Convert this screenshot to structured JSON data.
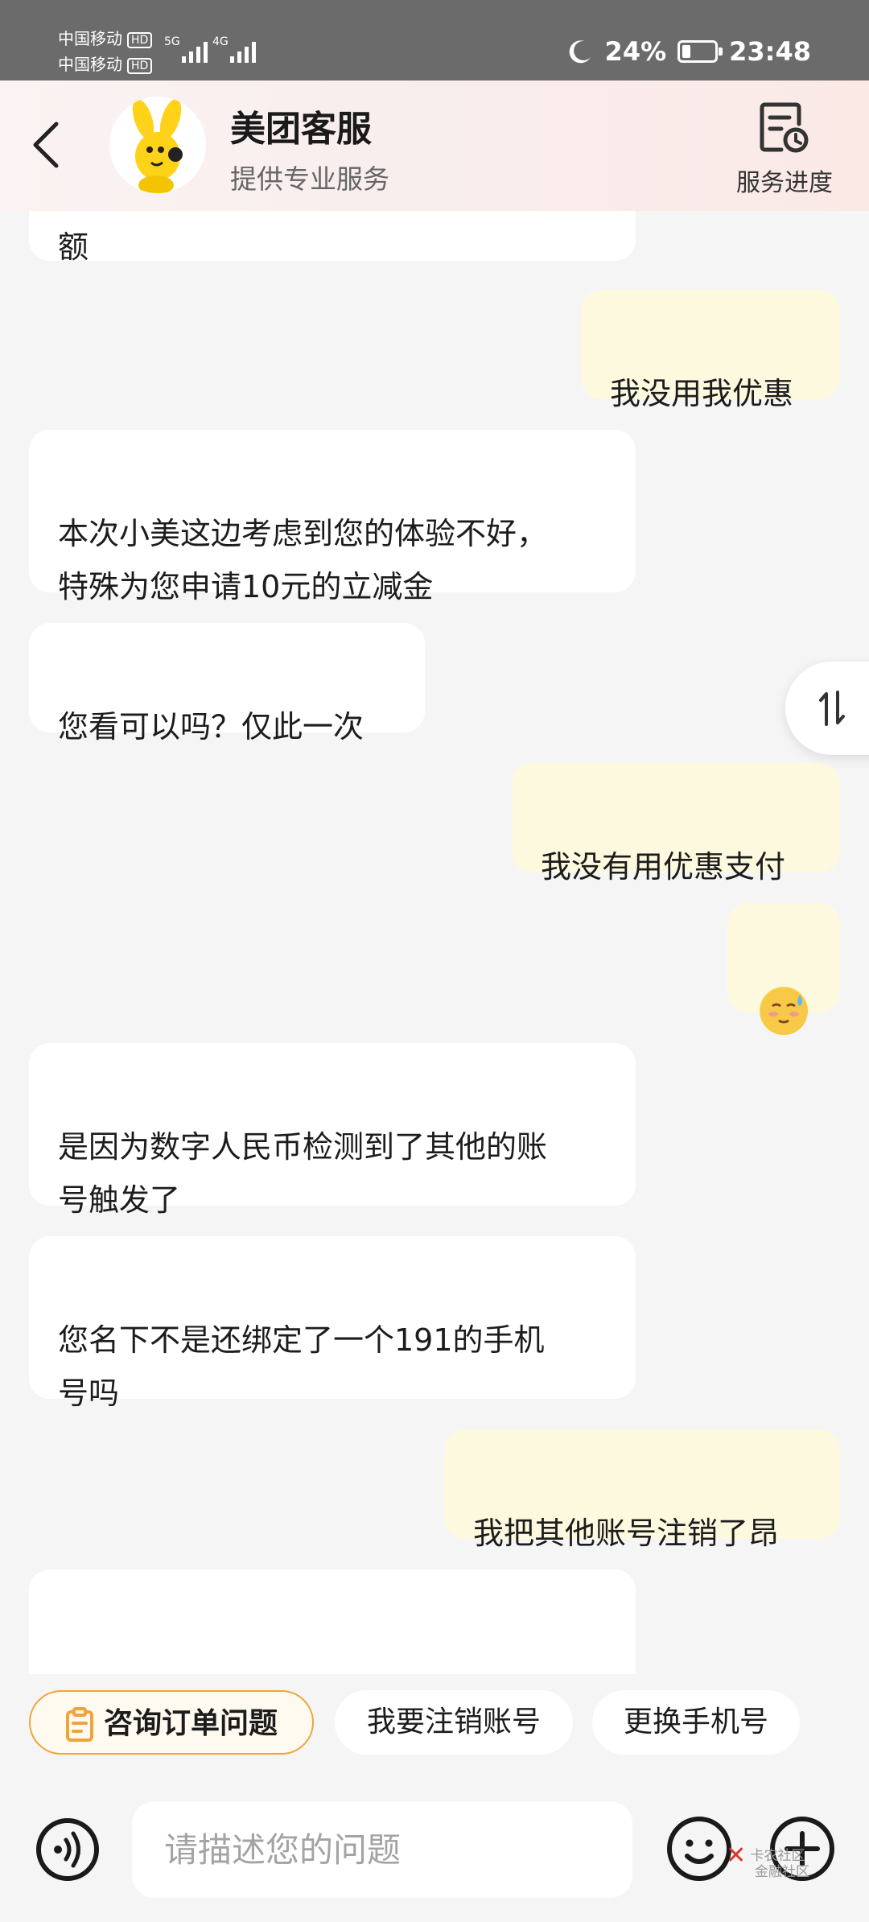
{
  "status_bar": {
    "carrier1": "中国移动",
    "carrier2": "中国移动",
    "hd": "HD",
    "net1": "5G",
    "net2": "4G",
    "battery": "24%",
    "time": "23:48"
  },
  "header": {
    "title": "美团客服",
    "subtitle": "提供专业服务",
    "progress_label": "服务进度"
  },
  "messages": [
    {
      "side": "left",
      "text": "额"
    },
    {
      "side": "right",
      "text": "我没用我优惠"
    },
    {
      "side": "left",
      "text": "本次小美这边考虑到您的体验不好，\n特殊为您申请10元的立减金"
    },
    {
      "side": "left",
      "text": "您看可以吗？仅此一次"
    },
    {
      "side": "right",
      "text": "我没有用优惠支付"
    },
    {
      "side": "right",
      "emoji": "sweat-smile-emoji"
    },
    {
      "side": "left",
      "text": "是因为数字人民币检测到了其他的账\n号触发了"
    },
    {
      "side": "left",
      "text": "您名下不是还绑定了一个191的手机\n号吗"
    },
    {
      "side": "right",
      "text": "我把其他账号注销了昂"
    },
    {
      "side": "left",
      "text": ""
    }
  ],
  "quick_replies": [
    "咨询订单问题",
    "我要注销账号",
    "更换手机号"
  ],
  "input": {
    "placeholder": "请描述您的问题",
    "value": ""
  },
  "watermark": {
    "line1": "卡农社区",
    "line2": "金融社区"
  },
  "colors": {
    "user_bubble": "#fdf9df",
    "agent_bubble": "#ffffff",
    "chip_accent": "#f0a33a",
    "background": "#f5f5f5"
  }
}
